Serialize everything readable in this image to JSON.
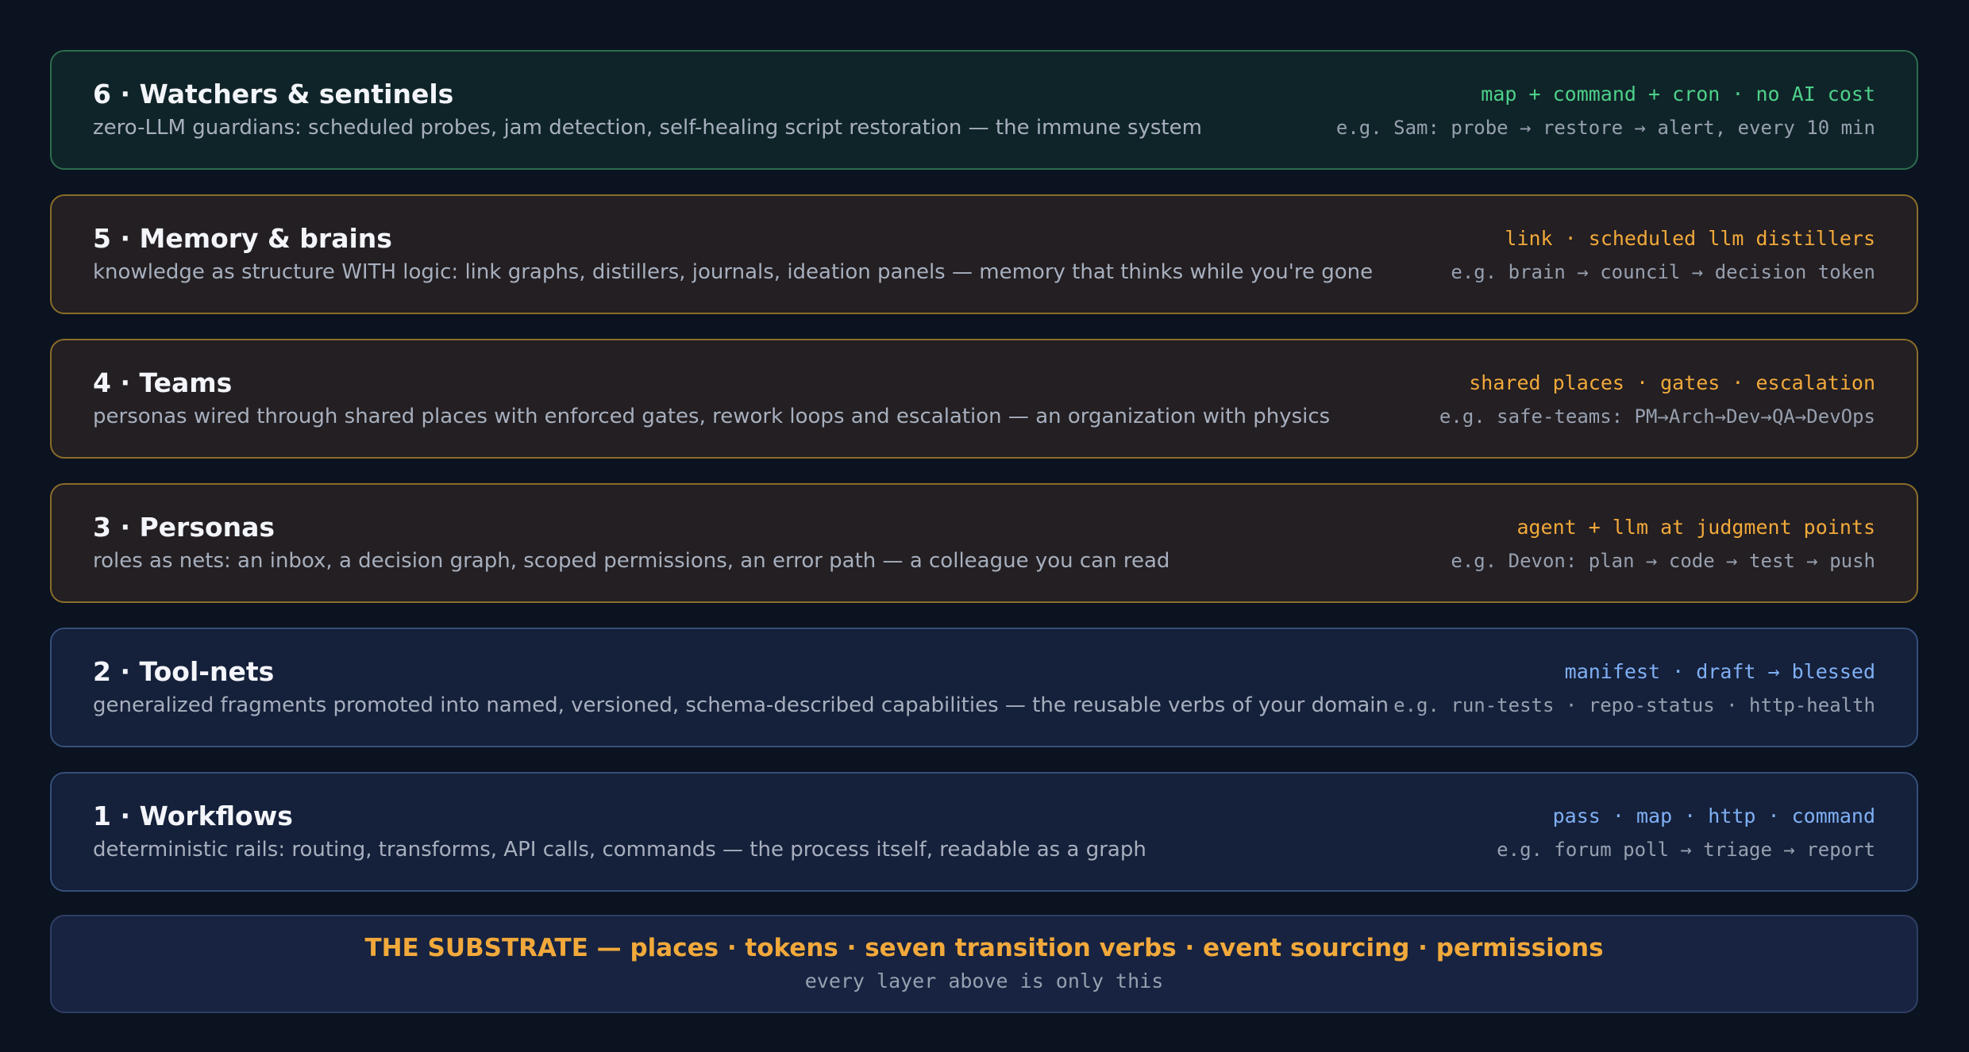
{
  "colors": {
    "background": "#0b1220",
    "green_accent": "#4ed08a",
    "amber_accent": "#f2a93b",
    "blue_accent": "#7fb0f5"
  },
  "layers": [
    {
      "title": "6 · Watchers & sentinels",
      "description": "zero-LLM guardians: scheduled probes, jam detection, self-healing script restoration — the immune system",
      "tag": "map + command + cron · no AI cost",
      "example": "e.g. Sam: probe → restore → alert, every 10 min",
      "theme": "green"
    },
    {
      "title": "5 · Memory & brains",
      "description": "knowledge as structure WITH logic: link graphs, distillers, journals, ideation panels — memory that thinks while you're gone",
      "tag": "link · scheduled llm distillers",
      "example": "e.g. brain → council → decision token",
      "theme": "amber"
    },
    {
      "title": "4 · Teams",
      "description": "personas wired through shared places with enforced gates, rework loops and escalation — an organization with physics",
      "tag": "shared places · gates · escalation",
      "example": "e.g. safe-teams: PM→Arch→Dev→QA→DevOps",
      "theme": "amber"
    },
    {
      "title": "3 · Personas",
      "description": "roles as nets: an inbox, a decision graph, scoped permissions, an error path — a colleague you can read",
      "tag": "agent + llm at judgment points",
      "example": "e.g. Devon: plan → code → test → push",
      "theme": "amber"
    },
    {
      "title": "2 · Tool-nets",
      "description": "generalized fragments promoted into named, versioned, schema-described capabilities — the reusable verbs of your domain",
      "tag": "manifest · draft → blessed",
      "example": "e.g. run-tests · repo-status · http-health",
      "theme": "blue"
    },
    {
      "title": "1 · Workflows",
      "description": "deterministic rails: routing, transforms, API calls, commands — the process itself, readable as a graph",
      "tag": "pass · map · http · command",
      "example": "e.g. forum poll → triage → report",
      "theme": "blue"
    }
  ],
  "substrate": {
    "title": "THE SUBSTRATE — places · tokens · seven transition verbs · event sourcing · permissions",
    "note": "every layer above is only this"
  }
}
